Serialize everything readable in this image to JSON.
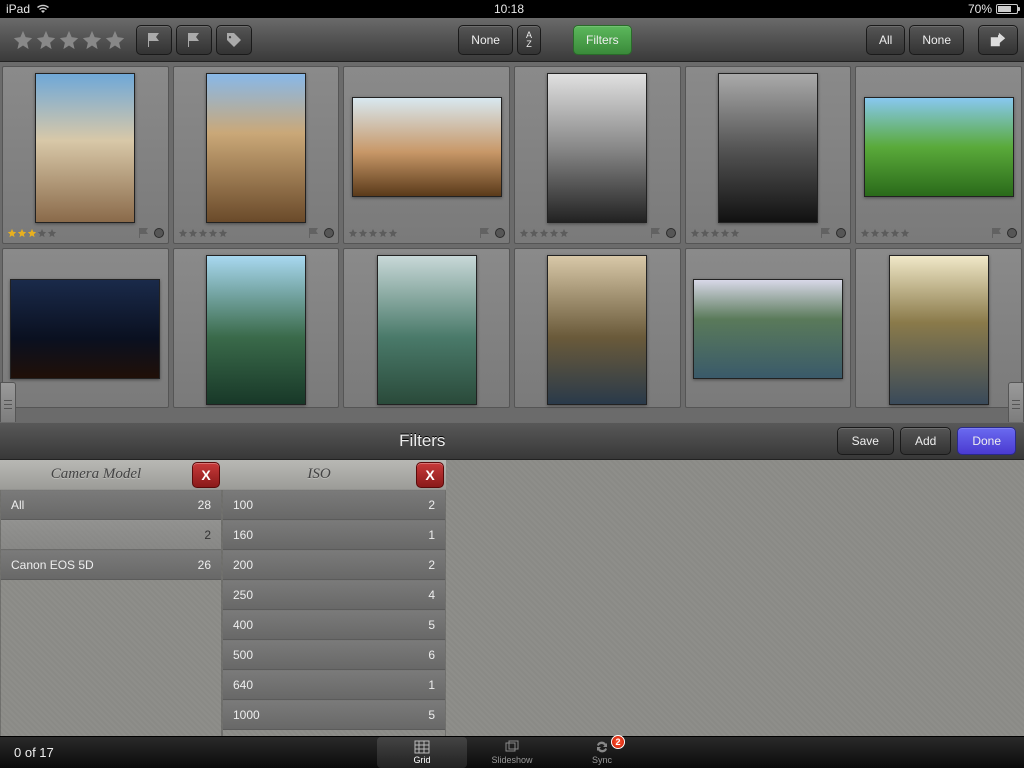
{
  "status": {
    "device": "iPad",
    "time": "10:18",
    "battery_pct": "70%"
  },
  "toolbar": {
    "none_btn": "None",
    "sort_btn": "A Z",
    "filters_btn": "Filters",
    "all_btn": "All",
    "none2_btn": "None"
  },
  "grid": {
    "row1": [
      {
        "orient": "portrait",
        "rating": 3,
        "grad": "g1"
      },
      {
        "orient": "portrait",
        "rating": 0,
        "grad": "g2"
      },
      {
        "orient": "landscape",
        "rating": 0,
        "grad": "g3"
      },
      {
        "orient": "portrait",
        "rating": 0,
        "grad": "g4"
      },
      {
        "orient": "portrait",
        "rating": 0,
        "grad": "g5"
      },
      {
        "orient": "landscape",
        "rating": 0,
        "grad": "g6"
      }
    ],
    "row2": [
      {
        "orient": "landscape",
        "grad": "g7"
      },
      {
        "orient": "portrait",
        "grad": "g8"
      },
      {
        "orient": "portrait",
        "grad": "g9"
      },
      {
        "orient": "portrait",
        "grad": "g10"
      },
      {
        "orient": "landscape",
        "grad": "g11"
      },
      {
        "orient": "portrait",
        "grad": "g12"
      }
    ]
  },
  "filters": {
    "title": "Filters",
    "save": "Save",
    "add": "Add",
    "done": "Done",
    "camera": {
      "heading": "Camera Model",
      "rows": [
        {
          "name": "All",
          "count": "28",
          "selected": false
        },
        {
          "name": "",
          "count": "2",
          "selected": true,
          "blank": true
        },
        {
          "name": "Canon EOS 5D",
          "count": "26",
          "selected": false
        }
      ]
    },
    "iso": {
      "heading": "ISO",
      "rows": [
        {
          "name": "100",
          "count": "2"
        },
        {
          "name": "160",
          "count": "1"
        },
        {
          "name": "200",
          "count": "2"
        },
        {
          "name": "250",
          "count": "4"
        },
        {
          "name": "400",
          "count": "5"
        },
        {
          "name": "500",
          "count": "6"
        },
        {
          "name": "640",
          "count": "1"
        },
        {
          "name": "1000",
          "count": "5"
        }
      ]
    }
  },
  "tabbar": {
    "counter": "0 of 17",
    "grid": "Grid",
    "slideshow": "Slideshow",
    "sync": "Sync",
    "sync_badge": "2"
  }
}
